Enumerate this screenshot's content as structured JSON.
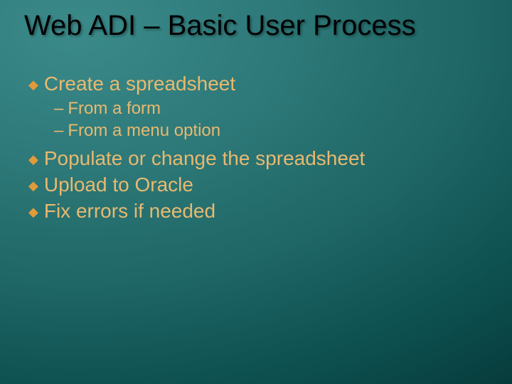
{
  "title": "Web ADI – Basic User Process",
  "bullets": {
    "b1": "Create a spreadsheet",
    "b1a": "From a form",
    "b1b": "From a menu option",
    "b2": "Populate or change the spreadsheet",
    "b3": "Upload to Oracle",
    "b4": "Fix errors if needed"
  },
  "markers": {
    "diamond": "◆",
    "dash": "–"
  }
}
